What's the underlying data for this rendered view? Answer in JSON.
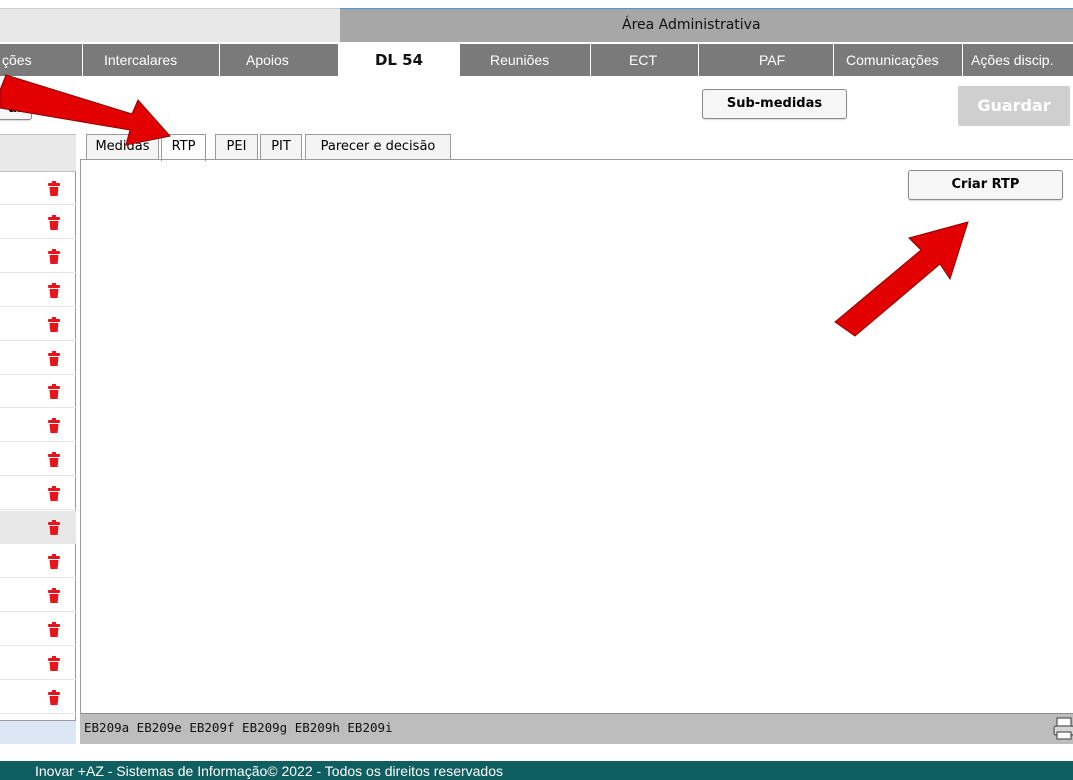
{
  "header": {
    "area_title": "Área Administrativa"
  },
  "nav": {
    "items": [
      {
        "label": "ções",
        "active": false
      },
      {
        "label": "Intercalares",
        "active": false
      },
      {
        "label": "Apoios",
        "active": false
      },
      {
        "label": "DL 54",
        "active": true
      },
      {
        "label": "Reuniões",
        "active": false
      },
      {
        "label": "ECT",
        "active": false
      },
      {
        "label": "PAF",
        "active": false
      },
      {
        "label": "Comunicações",
        "active": false
      },
      {
        "label": "Ações discip.",
        "active": false
      }
    ]
  },
  "toolbar": {
    "left_button_label": "ar",
    "submedidas_label": "Sub-medidas",
    "guardar_label": "Guardar"
  },
  "subtabs": [
    {
      "label": "Medidas",
      "active": false
    },
    {
      "label": "RTP",
      "active": true
    },
    {
      "label": "PEI",
      "active": false
    },
    {
      "label": "PIT",
      "active": false
    },
    {
      "label": "Parecer e decisão",
      "active": false
    }
  ],
  "content": {
    "criar_rtp_label": "Criar RTP"
  },
  "status": {
    "text": "EB209a EB209e EB209f EB209g EB209h EB209i"
  },
  "footer": {
    "text": "Inovar +AZ - Sistemas de Informação© 2022 - Todos os direitos reservados"
  },
  "colors": {
    "accent_red": "#e8141b",
    "nav_bg": "#7a7a7a",
    "footer_bg": "#0f5e60",
    "annotation_arrow": "#e30000"
  },
  "left_list": {
    "row_count": 16,
    "selected_row_index": 10,
    "row_icon": "trash-icon"
  }
}
